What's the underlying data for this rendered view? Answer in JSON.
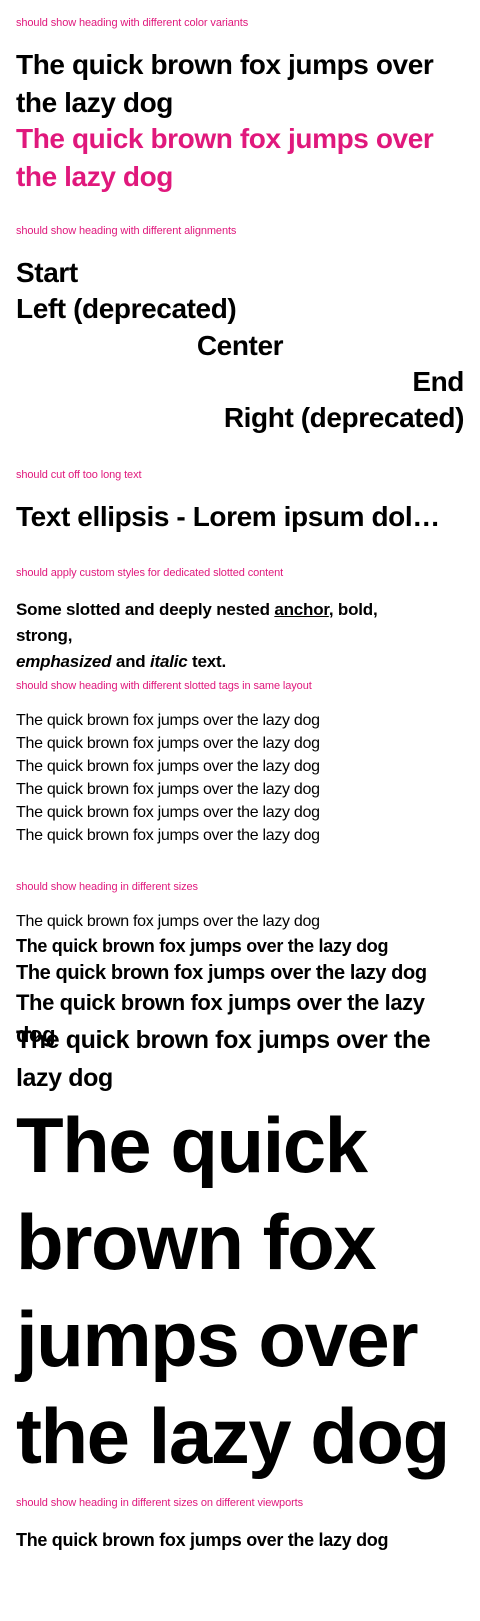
{
  "sections": {
    "color_variants": {
      "label": "should show heading with different color variants",
      "default_text": "The quick brown fox jumps over the lazy dog",
      "inherit_text": "The quick brown fox jumps over the lazy dog",
      "accent_color": "#e0187c"
    },
    "alignments": {
      "label": "should show heading with different alignments",
      "start": "Start",
      "left": "Left (deprecated)",
      "center": "Center",
      "end": "End",
      "right": "Right (deprecated)"
    },
    "ellipsis": {
      "label": "should cut off too long text",
      "text": "Text ellipsis - Lorem ipsum dolor sit amet, consetetur sadipscing elitr, sed diam nonumy eirmod tempor"
    },
    "slotted": {
      "label": "should apply custom styles for dedicated slotted content",
      "part1": "Some slotted and deeply nested ",
      "anchor": "anchor",
      "part2": ", ",
      "bold": "bold",
      "part3": ", ",
      "strong": "strong",
      "part4": ",",
      "emphasized": "emphasized",
      "part5": " and ",
      "italic": "italic",
      "part6": " text."
    },
    "slotted_tags": {
      "label": "should show heading with different slotted tags in same layout",
      "lines": [
        "The quick brown fox jumps over the lazy dog",
        "The quick brown fox jumps over the lazy dog",
        "The quick brown fox jumps over the lazy dog",
        "The quick brown fox jumps over the lazy dog",
        "The quick brown fox jumps over the lazy dog",
        "The quick brown fox jumps over the lazy dog"
      ]
    },
    "sizes": {
      "label": "should show heading in different sizes",
      "lines": [
        "The quick brown fox jumps over the lazy dog",
        "The quick brown fox jumps over the lazy dog",
        "The quick brown fox jumps over the lazy dog",
        "The quick brown fox jumps over the lazy dog",
        "The quick brown fox jumps over the lazy dog",
        "The quick brown fox jumps over the lazy dog"
      ]
    },
    "viewports": {
      "label": "should show heading in different sizes on different viewports",
      "text": "The quick brown fox jumps over the lazy dog"
    }
  }
}
